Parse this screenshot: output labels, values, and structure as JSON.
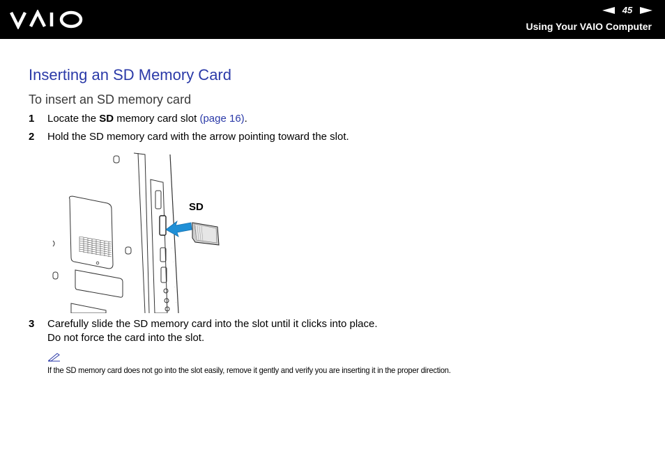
{
  "header": {
    "brand": "VAIO",
    "page_number": "45",
    "section_title": "Using Your VAIO Computer"
  },
  "content": {
    "heading": "Inserting an SD Memory Card",
    "subheading": "To insert an SD memory card",
    "steps": [
      {
        "number": "1",
        "before": "Locate the ",
        "bold": "SD",
        "after": " memory card slot ",
        "link": "(page 16)",
        "end": "."
      },
      {
        "number": "2",
        "text": "Hold the SD memory card with the arrow pointing toward the slot."
      },
      {
        "number": "3",
        "text": "Carefully slide the SD memory card into the slot until it clicks into place.",
        "subtext": "Do not force the card into the slot."
      }
    ],
    "figure": {
      "label": "SD"
    },
    "note": {
      "icon": "pencil-note-icon",
      "text": "If the SD memory card does not go into the slot easily, remove it gently and verify you are inserting it in the proper direction."
    }
  },
  "colors": {
    "header_bg": "#000000",
    "heading": "#2b3aa8",
    "link": "#2b3aa8",
    "arrow": "#1f8fd6"
  }
}
